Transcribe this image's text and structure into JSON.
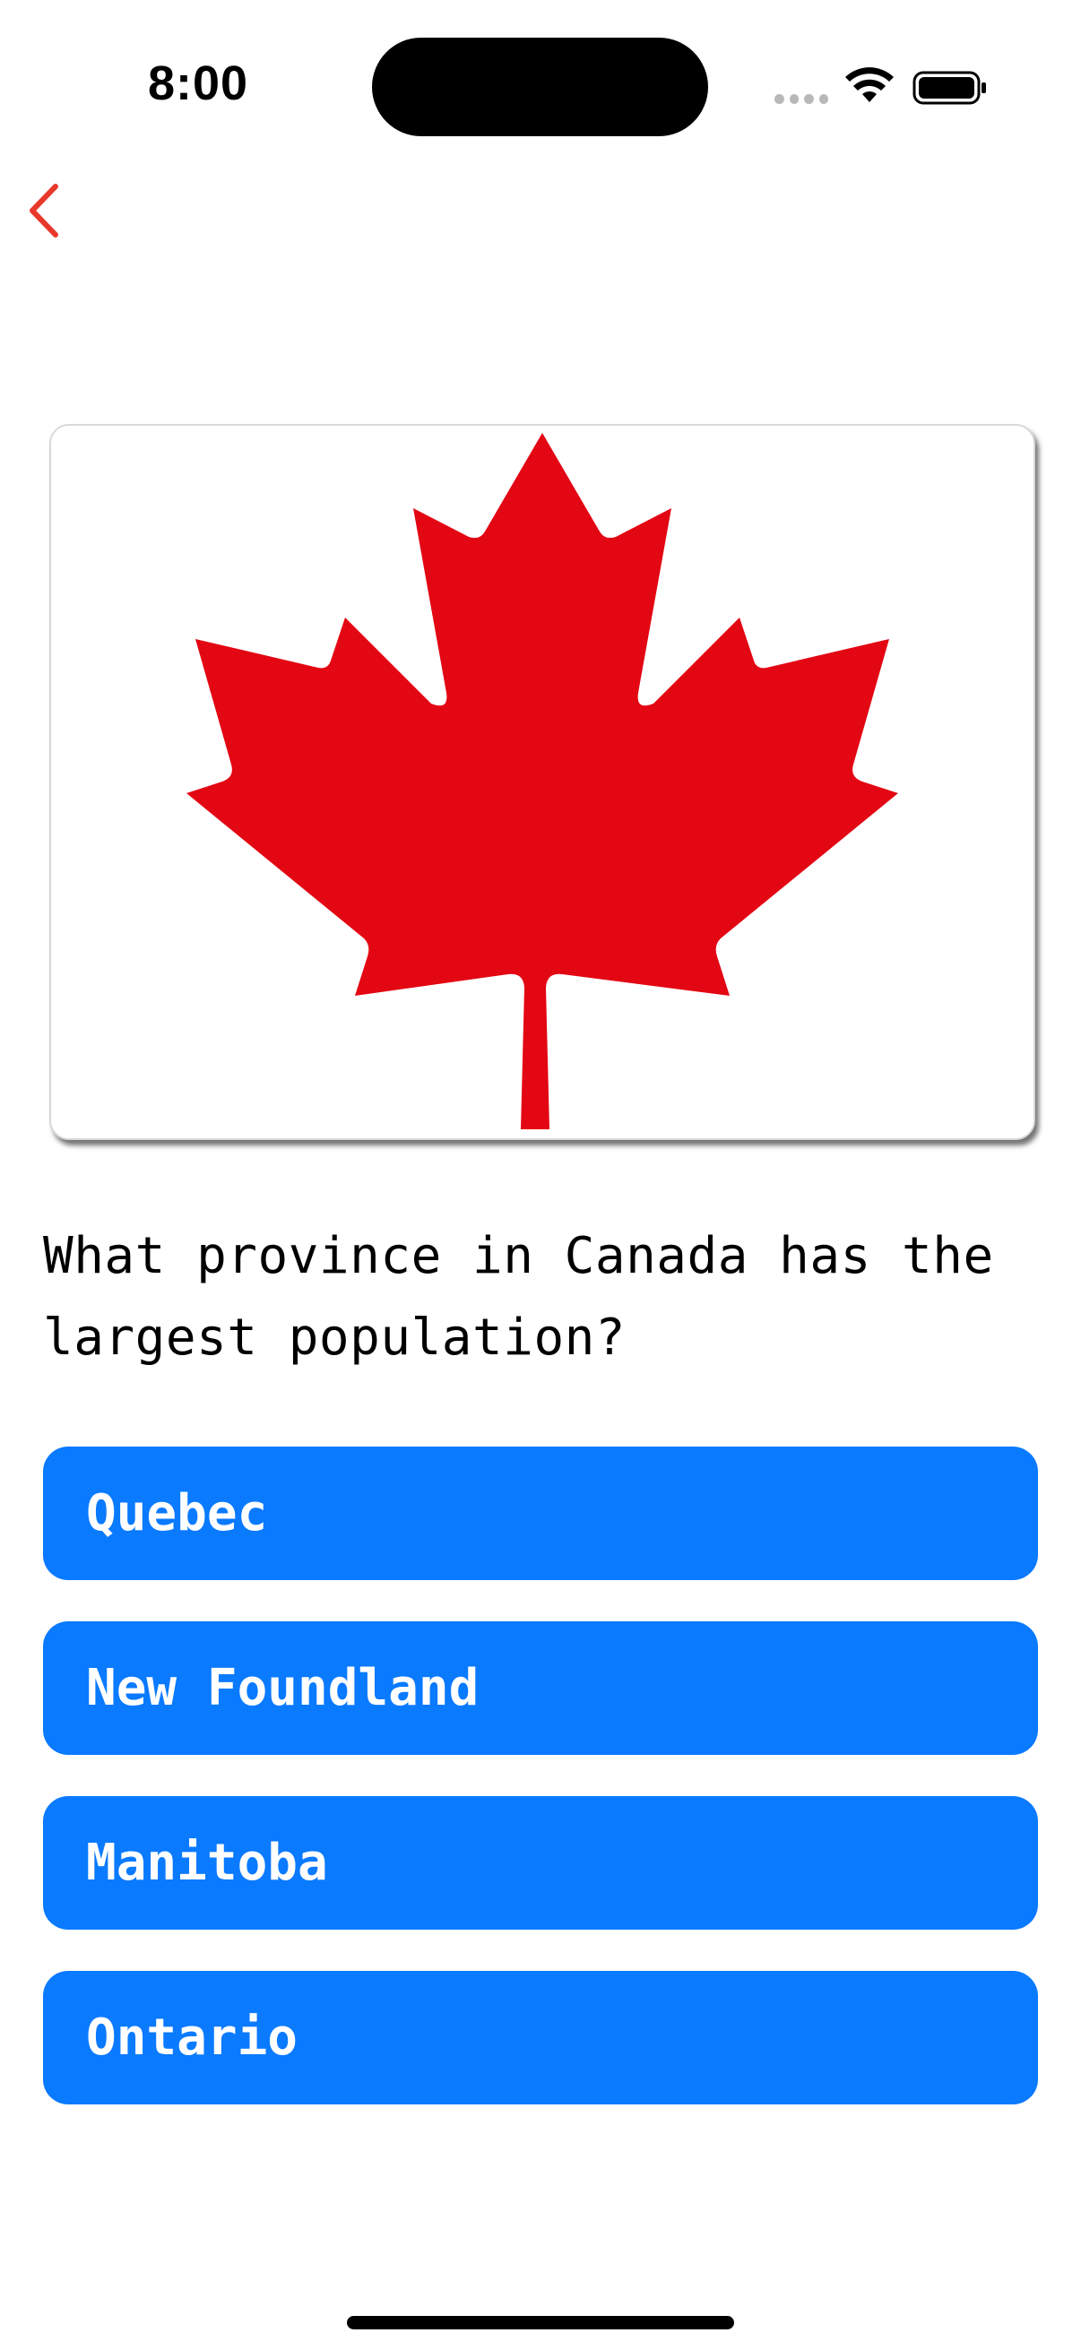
{
  "status_bar": {
    "time": "8:00",
    "icons": [
      "cellular-dots-icon",
      "wifi-icon",
      "battery-icon"
    ]
  },
  "navigation": {
    "back_icon": "chevron-left-icon",
    "accent_color": "#e8372b"
  },
  "flag": {
    "country": "Canada",
    "leaf_color": "#e30613",
    "background_color": "#ffffff"
  },
  "question": {
    "text": "What province in Canada has the largest population?"
  },
  "answers": [
    {
      "label": "Quebec"
    },
    {
      "label": "New Foundland"
    },
    {
      "label": "Manitoba"
    },
    {
      "label": "Ontario"
    }
  ],
  "colors": {
    "answer_button": "#0a7aff",
    "answer_text": "#ffffff"
  }
}
